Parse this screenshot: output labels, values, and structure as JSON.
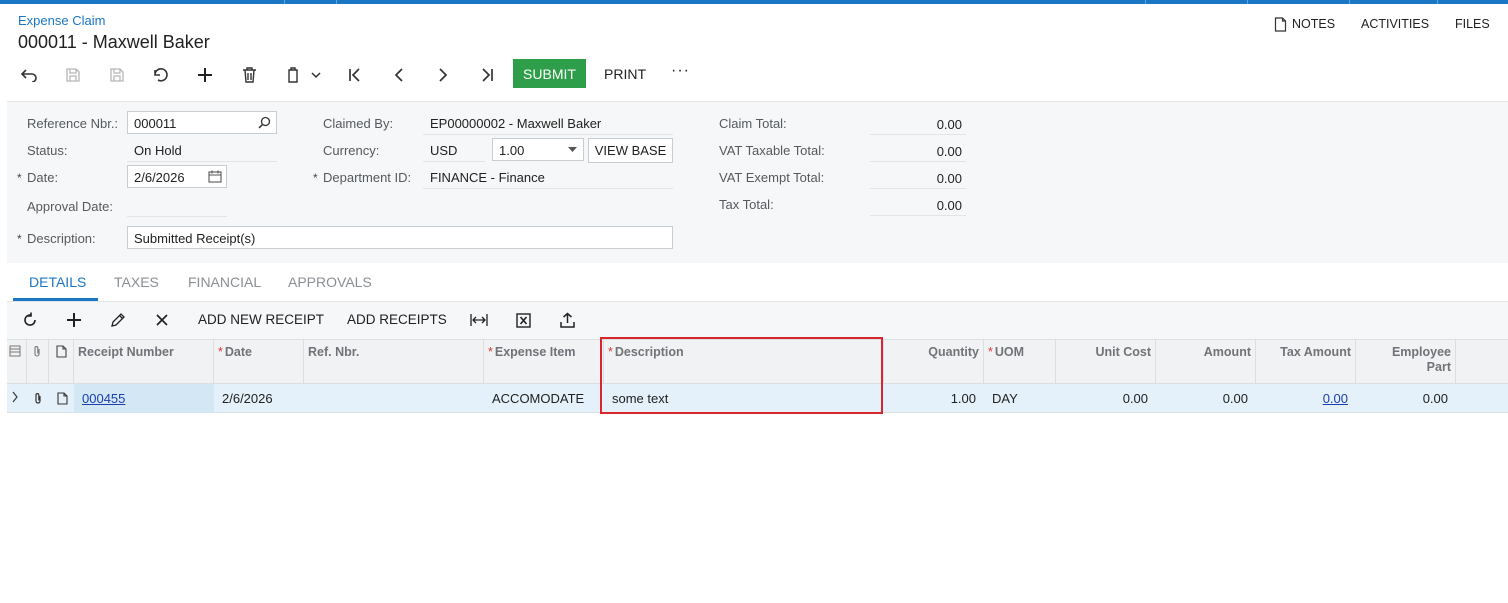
{
  "breadcrumb": "Expense Claim",
  "title": "000011 - Maxwell Baker",
  "top_links": {
    "notes": "NOTES",
    "activities": "ACTIVITIES",
    "files": "FILES"
  },
  "toolbar": {
    "submit": "SUBMIT",
    "print": "PRINT",
    "more": "···"
  },
  "form": {
    "ref_nbr_label": "Reference Nbr.:",
    "ref_nbr_value": "000011",
    "status_label": "Status:",
    "status_value": "On Hold",
    "date_label": "Date:",
    "date_value": "2/6/2026",
    "approval_date_label": "Approval Date:",
    "description_label": "Description:",
    "description_value": "Submitted Receipt(s)",
    "claimed_by_label": "Claimed By:",
    "claimed_by_value": "EP00000002 - Maxwell Baker",
    "currency_label": "Currency:",
    "currency_value": "USD",
    "currency_rate": "1.00",
    "view_base": "VIEW BASE",
    "department_label": "Department ID:",
    "department_value": "FINANCE - Finance",
    "claim_total_label": "Claim Total:",
    "claim_total_value": "0.00",
    "vat_taxable_label": "VAT Taxable Total:",
    "vat_taxable_value": "0.00",
    "vat_exempt_label": "VAT Exempt Total:",
    "vat_exempt_value": "0.00",
    "tax_total_label": "Tax Total:",
    "tax_total_value": "0.00",
    "required_mark": "*"
  },
  "tabs": [
    "DETAILS",
    "TAXES",
    "FINANCIAL",
    "APPROVALS"
  ],
  "grid_toolbar": {
    "add_new_receipt": "ADD NEW RECEIPT",
    "add_receipts": "ADD RECEIPTS"
  },
  "grid": {
    "columns": {
      "receipt_number": "Receipt Number",
      "date": "Date",
      "ref_nbr": "Ref. Nbr.",
      "expense_item": "Expense Item",
      "description": "Description",
      "quantity": "Quantity",
      "uom": "UOM",
      "unit_cost": "Unit Cost",
      "amount": "Amount",
      "tax_amount": "Tax Amount",
      "employee_part_1": "Employee",
      "employee_part_2": "Part"
    },
    "row": {
      "receipt_number": "000455",
      "date": "2/6/2026",
      "ref_nbr": "",
      "expense_item": "ACCOMODATE",
      "description": "some text",
      "quantity": "1.00",
      "uom": "DAY",
      "unit_cost": "0.00",
      "amount": "0.00",
      "tax_amount": "0.00",
      "employee_part": "0.00"
    }
  },
  "colors": {
    "accent": "#1b76c6",
    "submit": "#2e9e4b",
    "required": "#e03a3a",
    "highlight": "#d9262c"
  }
}
